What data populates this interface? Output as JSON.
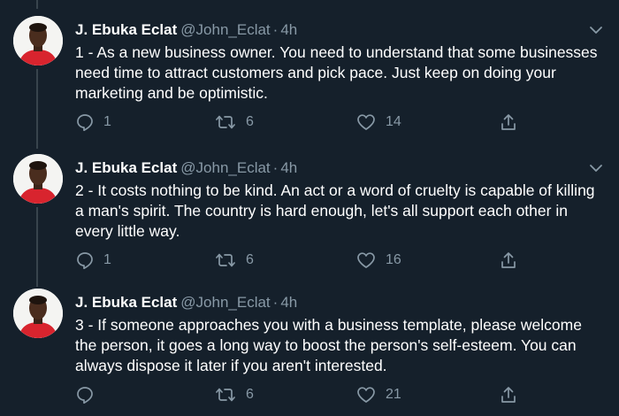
{
  "tweets": [
    {
      "name": "J. Ebuka Eclat",
      "handle": "@John_Eclat",
      "separator": "·",
      "time": "4h",
      "text": "1 - As a new business owner. You need to understand that some businesses need time to attract customers and pick pace. Just keep on doing your marketing and be optimistic.",
      "replies": "1",
      "retweets": "6",
      "likes": "14"
    },
    {
      "name": "J. Ebuka Eclat",
      "handle": "@John_Eclat",
      "separator": "·",
      "time": "4h",
      "text": "2 - It costs nothing to be kind. An act or a word of cruelty is capable of killing a man's spirit. The country is hard enough, let's all support each other in every little way.",
      "replies": "1",
      "retweets": "6",
      "likes": "16"
    },
    {
      "name": "J. Ebuka Eclat",
      "handle": "@John_Eclat",
      "separator": "·",
      "time": "4h",
      "text": "3 - If someone approaches you with a business template, please welcome the person, it goes a long way to boost the person's self-esteem. You can always dispose it later if you aren't interested.",
      "replies": "",
      "retweets": "6",
      "likes": "21"
    }
  ],
  "icons": {
    "reply": "reply-icon",
    "retweet": "retweet-icon",
    "like": "heart-icon",
    "share": "share-icon",
    "menu": "chevron-down-icon",
    "avatar": "profile-photo"
  },
  "colors": {
    "background": "#15202b",
    "primary_text": "#ffffff",
    "secondary_text": "#8899a6",
    "thread_line": "#38444d"
  }
}
